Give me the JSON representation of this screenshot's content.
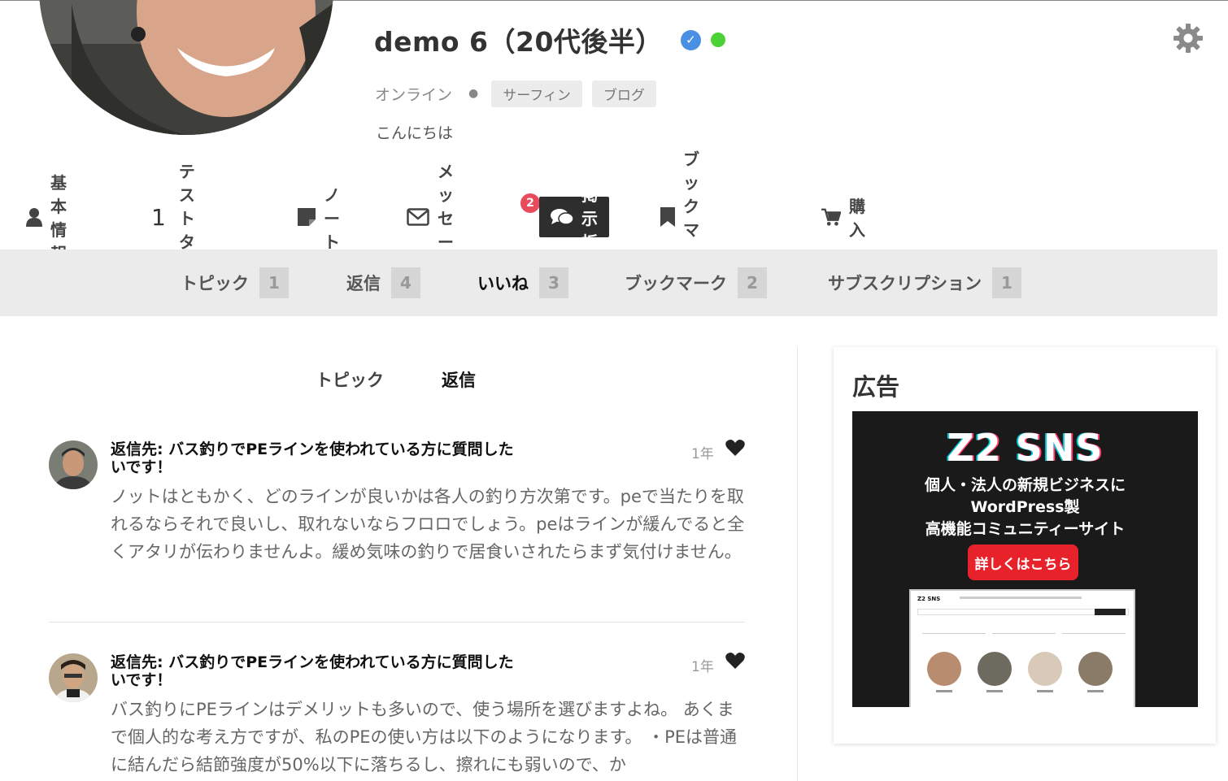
{
  "profile": {
    "name": "demo 6（20代後半）",
    "status": "オンライン",
    "tags": [
      "サーフィン",
      "ブログ"
    ],
    "bio": "こんにちは"
  },
  "main_nav": {
    "basic_info": "基本情報",
    "test_tab_number": "1",
    "test_tab": "テストタブ",
    "notes": "ノート",
    "messages": "メッセージ",
    "messages_badge": "2",
    "forum": "掲示板",
    "bookmarks": "ブックマーク",
    "purchase": "購入"
  },
  "sub_nav": [
    {
      "label": "トピック",
      "count": "1"
    },
    {
      "label": "返信",
      "count": "4"
    },
    {
      "label": "いいね",
      "count": "3"
    },
    {
      "label": "ブックマーク",
      "count": "2"
    },
    {
      "label": "サブスクリプション",
      "count": "1"
    }
  ],
  "content_tabs": {
    "topics": "トピック",
    "replies": "返信"
  },
  "posts": [
    {
      "title": "返信先: バス釣りでPEラインを使われている方に質問したいです！",
      "time": "1年",
      "body": "ノットはともかく、どのラインが良いかは各人の釣り方次第です。peで当たりを取れるならそれで良いし、取れないならフロロでしょう。peはラインが緩んでると全くアタリが伝わりませんよ。緩め気味の釣りで居食いされたらまず気付けません。"
    },
    {
      "title": "返信先: バス釣りでPEラインを使われている方に質問したいです！",
      "time": "1年",
      "body": "バス釣りにPEラインはデメリットも多いので、使う場所を選びますよね。 あくまで個人的な考え方ですが、私のPEの使い方は以下のようになります。 ・PEは普通に結んだら結節強度が50%以下に落ちるし、擦れにも弱いので、か"
    }
  ],
  "sidebar": {
    "ad_title": "広告",
    "ad": {
      "logo": "Z2 SNS",
      "line1": "個人・法人の新規ビジネスに",
      "line2": "WordPress製",
      "line3": "高機能コミュニティーサイト",
      "cta": "詳しくはこちら",
      "shot_logo": "Z2 SNS"
    }
  },
  "colors": {
    "accent_blue": "#4a90e2",
    "online_green": "#4cd137",
    "badge_red": "#e84c5c",
    "cta_red": "#e8222b",
    "active_tab": "#2e2e2e"
  }
}
